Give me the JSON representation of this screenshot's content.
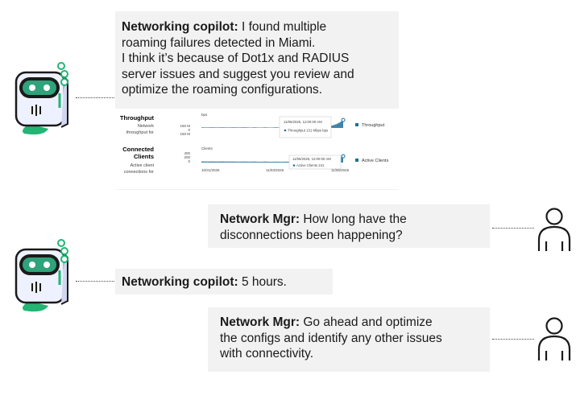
{
  "conversation": [
    {
      "speaker": "Networking copilot:",
      "text": "I found multiple roaming failures detected in Miami. I think it’s because of Dot1x and RADIUS server issues and suggest you review and optimize the roaming configurations.",
      "lines": [
        " I found multiple",
        "roaming failures detected in Miami.",
        "I think it’s because of Dot1x and RADIUS",
        "server issues and suggest you review and",
        "optimize the roaming configurations."
      ]
    },
    {
      "speaker": "Network Mgr:",
      "text": "How long have the disconnections been happening?",
      "lines": [
        " How long have the",
        "disconnections been happening?"
      ]
    },
    {
      "speaker": "Networking copilot:",
      "text": "5 hours.",
      "lines": [
        " 5 hours."
      ]
    },
    {
      "speaker": "Network Mgr:",
      "text": "Go ahead and optimize the configs and identify any other issues with connectivity.",
      "lines": [
        " Go ahead and optimize",
        "the configs and identify any other issues",
        "with connectivity."
      ]
    }
  ],
  "embedded_chart": {
    "throughput": {
      "title": "Throughput",
      "sub1": "Network",
      "sub2": "throughput for",
      "unit": "bps",
      "ticks": [
        "160 M",
        "0",
        "160 M"
      ],
      "tooltip_date": "11/06/2025, 12:00:00 AM",
      "tooltip_value": "Throughput  131 Mbps bps",
      "legend": "Throughput"
    },
    "clients": {
      "title": "Connected",
      "title2": "Clients",
      "sub1": "Active client",
      "sub2": "connections for",
      "unit": "Clients",
      "ticks": [
        "400",
        "200",
        "0"
      ],
      "tooltip_date": "11/06/2025, 12:00:00 AM",
      "tooltip_value": "Active Clients   241",
      "legend": "Active Clients"
    },
    "x_ticks": [
      "10/31/2025",
      "11/03/2025",
      "11/06/2025"
    ],
    "series_color": "#1f6f9c"
  },
  "chart_data": [
    {
      "type": "area",
      "title": "Throughput",
      "ylabel": "bps",
      "x": [
        "10/31/2025",
        "11/03/2025",
        "11/06/2025"
      ],
      "series": [
        {
          "name": "Throughput",
          "values": [
            8,
            7,
            131
          ]
        }
      ],
      "ylim": [
        0,
        160
      ]
    },
    {
      "type": "area",
      "title": "Connected Clients",
      "ylabel": "Clients",
      "x": [
        "10/31/2025",
        "11/03/2025",
        "11/06/2025"
      ],
      "series": [
        {
          "name": "Active Clients",
          "values": [
            40,
            30,
            241
          ]
        }
      ],
      "ylim": [
        0,
        400
      ]
    }
  ]
}
